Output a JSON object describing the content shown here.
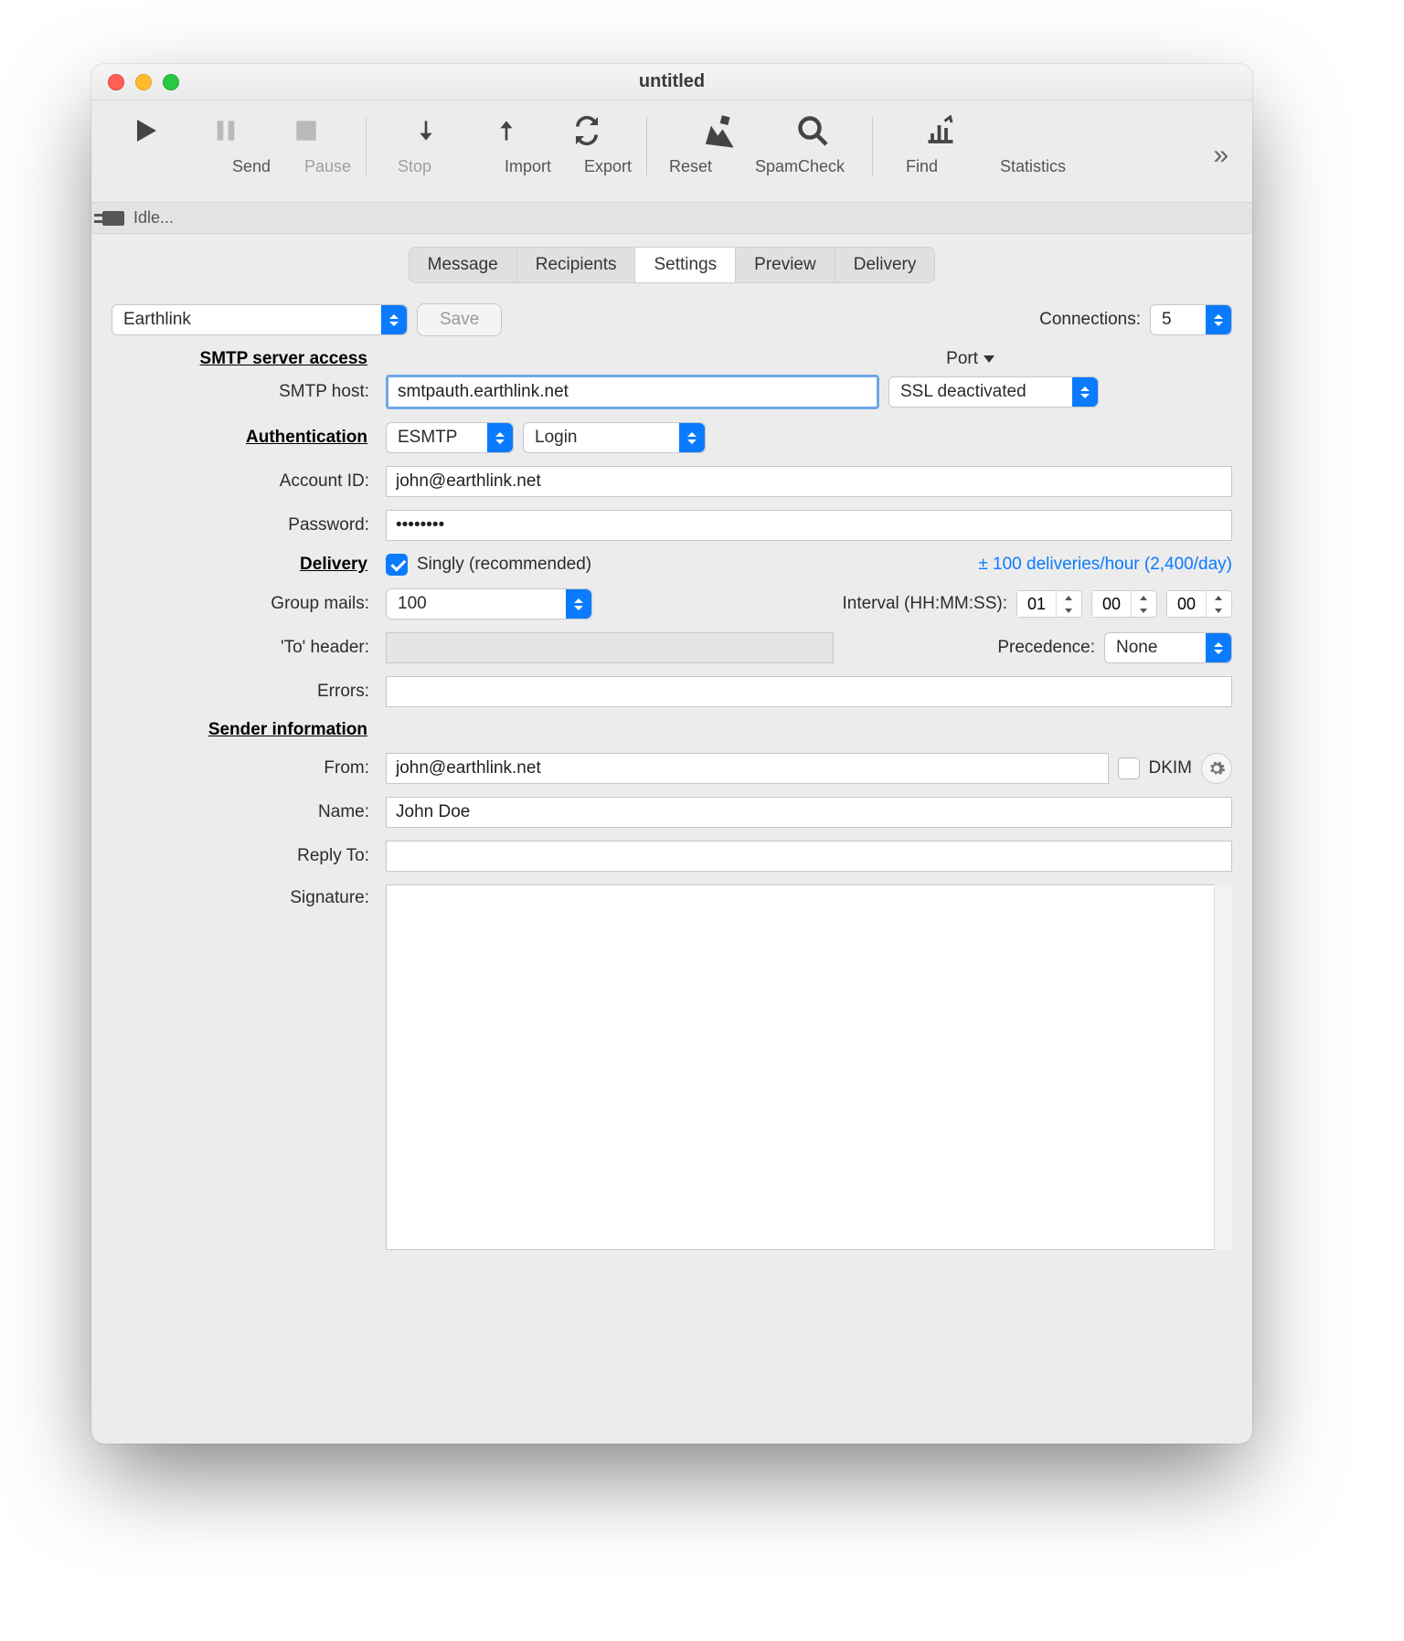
{
  "window": {
    "title": "untitled"
  },
  "toolbar": {
    "send": "Send",
    "pause": "Pause",
    "stop": "Stop",
    "import": "Import",
    "export": "Export",
    "reset": "Reset",
    "spamcheck": "SpamCheck",
    "find": "Find",
    "statistics": "Statistics"
  },
  "status": {
    "text": "Idle..."
  },
  "tabs": {
    "message": "Message",
    "recipients": "Recipients",
    "settings": "Settings",
    "preview": "Preview",
    "delivery": "Delivery"
  },
  "toprow": {
    "profile": "Earthlink",
    "save": "Save",
    "connections_label": "Connections:",
    "connections_value": "5"
  },
  "sections": {
    "smtp": "SMTP server access",
    "auth": "Authentication",
    "delivery": "Delivery",
    "sender": "Sender information"
  },
  "labels": {
    "smtp_host": "SMTP host:",
    "port": "Port",
    "account_id": "Account ID:",
    "password": "Password:",
    "group_mails": "Group mails:",
    "interval": "Interval (HH:MM:SS):",
    "to_header": "'To' header:",
    "precedence": "Precedence:",
    "errors": "Errors:",
    "from": "From:",
    "dkim": "DKIM",
    "name": "Name:",
    "reply_to": "Reply To:",
    "signature": "Signature:"
  },
  "values": {
    "smtp_host": "smtpauth.earthlink.net",
    "ssl_mode": "SSL deactivated",
    "auth_type": "ESMTP",
    "auth_method": "Login",
    "account_id": "john@earthlink.net",
    "password": "••••••••",
    "singly_label": "Singly (recommended)",
    "rate_link": "± 100 deliveries/hour (2,400/day)",
    "group_mails": "100",
    "interval_hh": "01",
    "interval_mm": "00",
    "interval_ss": "00",
    "to_header": "",
    "precedence": "None",
    "errors": "",
    "from": "john@earthlink.net",
    "name": "John Doe",
    "reply_to": "",
    "signature": ""
  }
}
